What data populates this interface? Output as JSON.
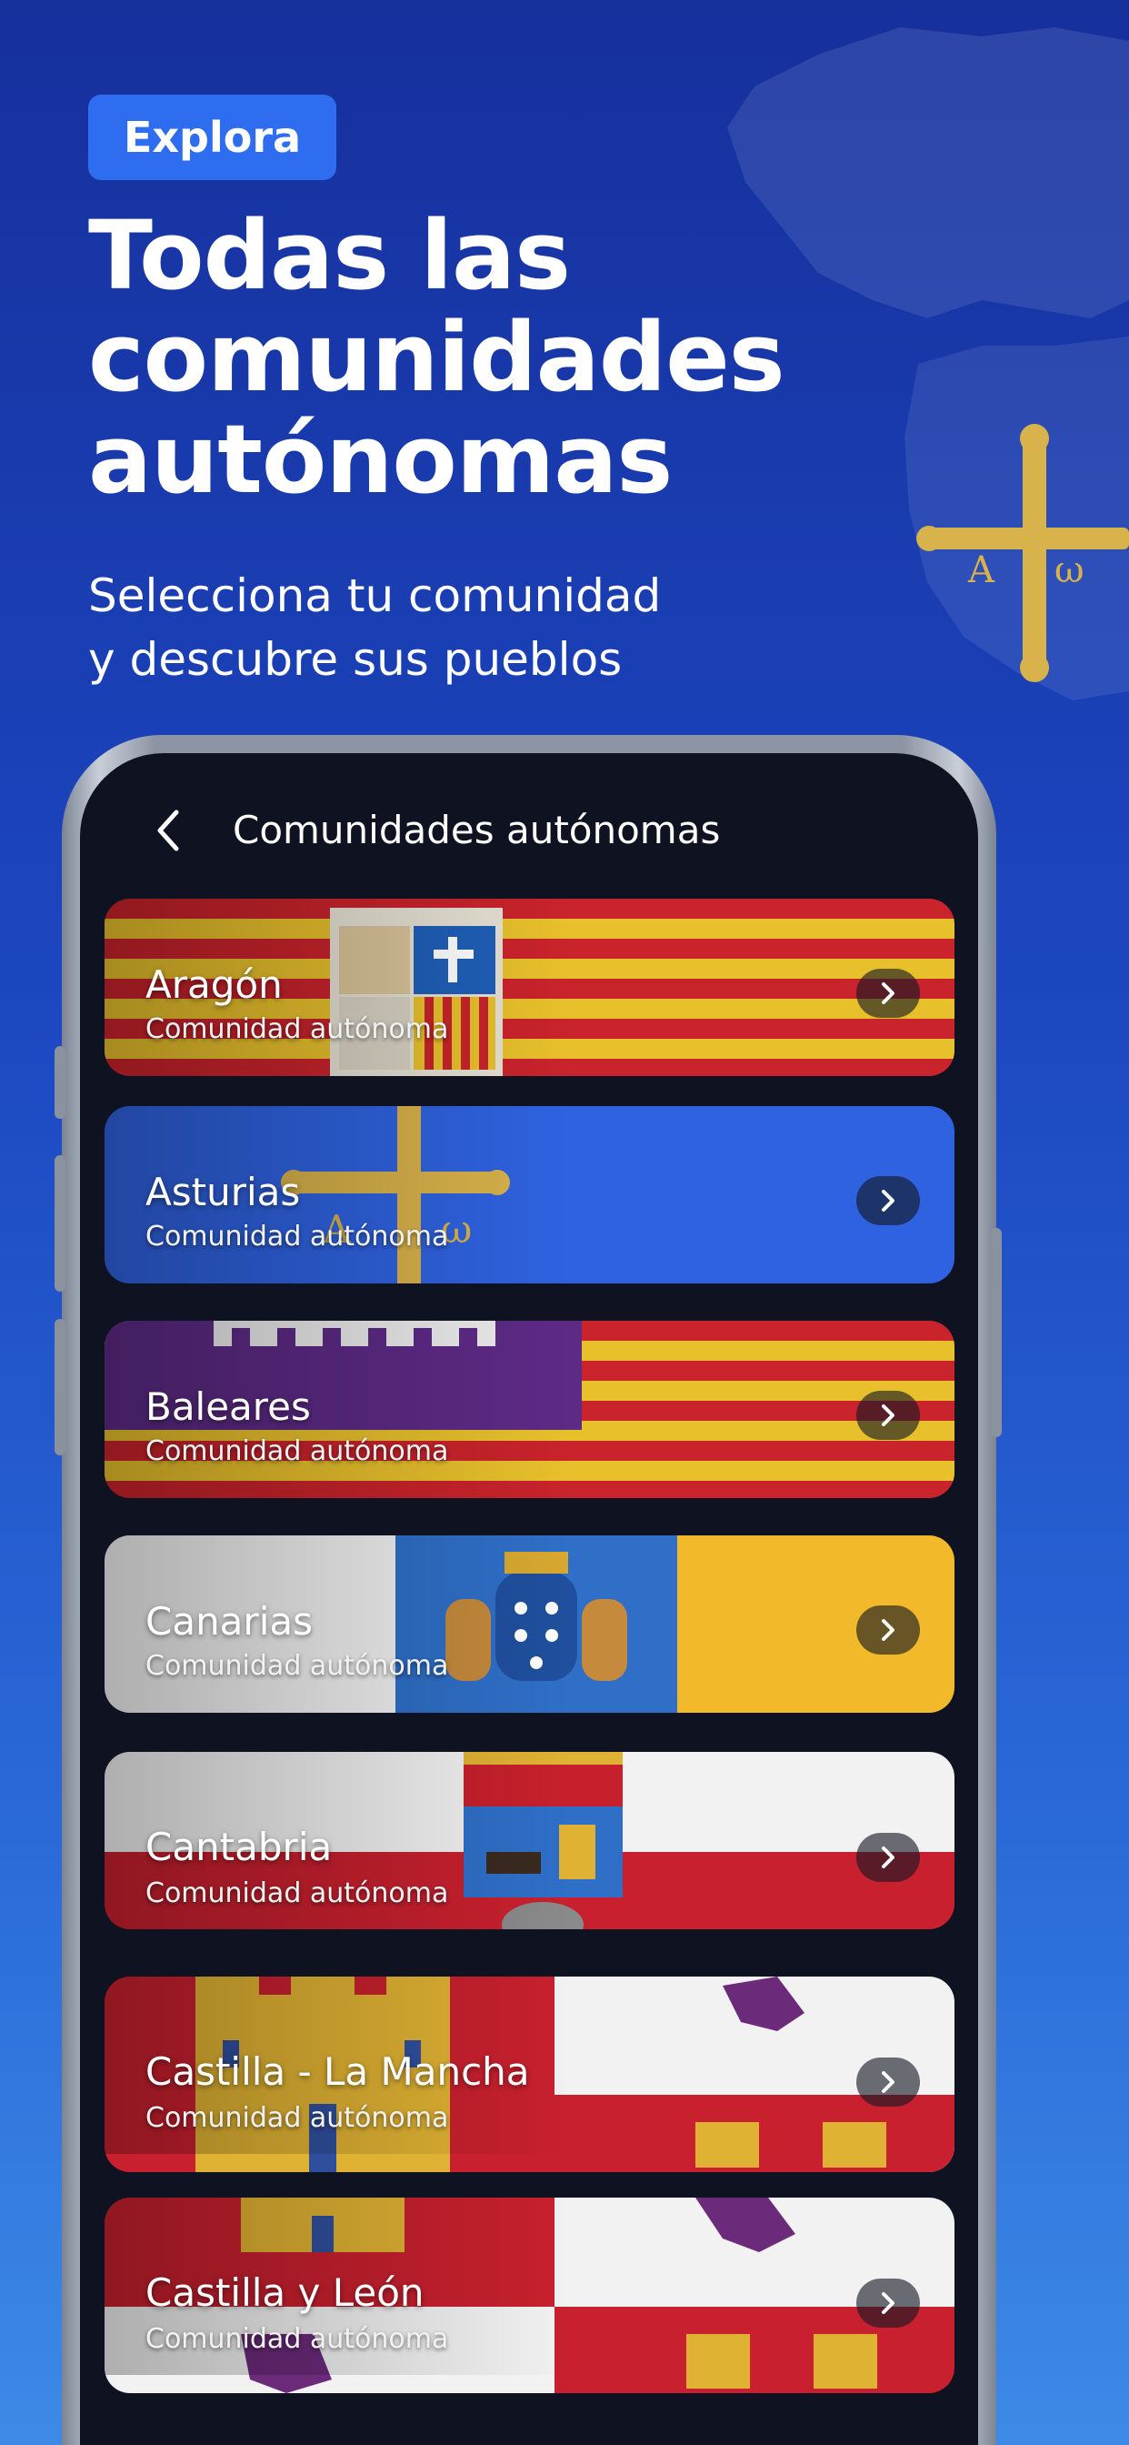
{
  "badge": "Explora",
  "headline": [
    "Todas las",
    "comunidades",
    "autónomas"
  ],
  "subtitle": [
    "Selecciona tu comunidad",
    "y descubre sus pueblos"
  ],
  "screen": {
    "title": "Comunidades autónomas",
    "back_icon": "chevron-left-icon",
    "item_icon": "chevron-right-icon"
  },
  "communities": [
    {
      "name": "Aragón",
      "subtitle": "Comunidad autónoma",
      "flag": "aragon"
    },
    {
      "name": "Asturias",
      "subtitle": "Comunidad autónoma",
      "flag": "asturias"
    },
    {
      "name": "Baleares",
      "subtitle": "Comunidad autónoma",
      "flag": "baleares"
    },
    {
      "name": "Canarias",
      "subtitle": "Comunidad autónoma",
      "flag": "canarias"
    },
    {
      "name": "Cantabria",
      "subtitle": "Comunidad autónoma",
      "flag": "cantabria"
    },
    {
      "name": "Castilla - La Mancha",
      "subtitle": "Comunidad autónoma",
      "flag": "castilla-la-mancha"
    },
    {
      "name": "Castilla y León",
      "subtitle": "Comunidad autónoma",
      "flag": "castilla-y-leon"
    }
  ],
  "colors": {
    "background_top": "#16309c",
    "background_bottom": "#3d8ae6",
    "badge": "#2f6df0",
    "screen": "#0f1220",
    "asturias_cross": "#d8b24a"
  }
}
